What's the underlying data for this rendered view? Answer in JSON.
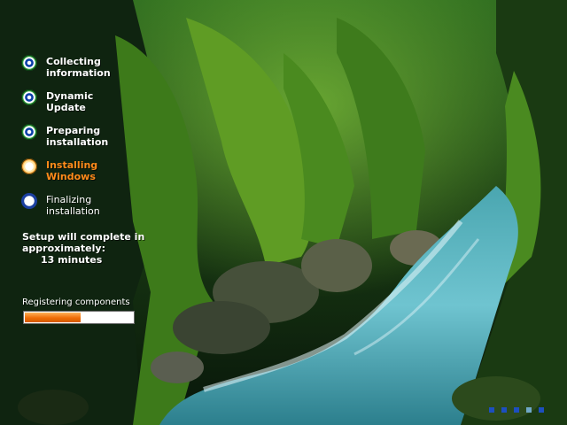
{
  "steps": [
    {
      "label": "Collecting\ninformation",
      "state": "done"
    },
    {
      "label": "Dynamic\nUpdate",
      "state": "done"
    },
    {
      "label": "Preparing\ninstallation",
      "state": "done"
    },
    {
      "label": "Installing\nWindows",
      "state": "current"
    },
    {
      "label": "Finalizing\ninstallation",
      "state": "pending"
    }
  ],
  "estimate": {
    "line1": "Setup will complete in",
    "line2": "approximately:",
    "time": "13 minutes"
  },
  "status": {
    "text": "Registering components",
    "progress": 0.52
  },
  "colors": {
    "accent_current": "#ff8a1a",
    "progress_fill": "#ef6d08"
  },
  "icons": {
    "done": "check-bullet-icon",
    "current": "current-bullet-icon",
    "pending": "pending-bullet-icon"
  }
}
